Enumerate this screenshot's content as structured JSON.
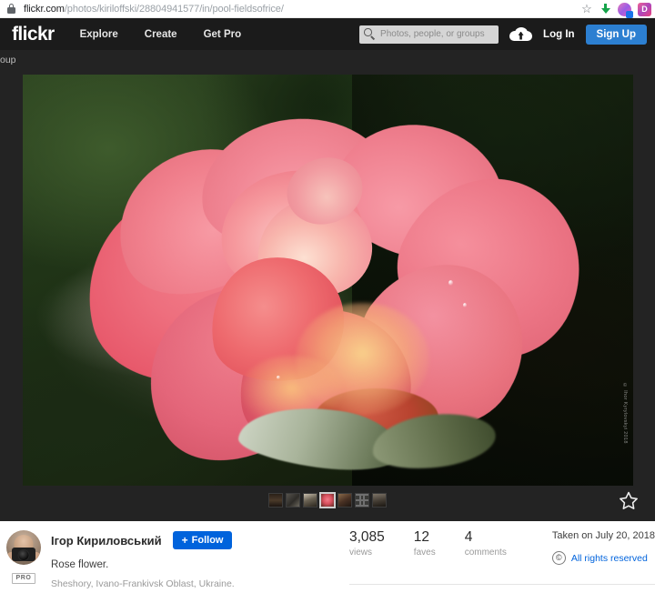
{
  "browser": {
    "url_host": "flickr.com",
    "url_path": "/photos/kiriloffski/28804941577/in/pool-fieldsofrice/",
    "lock_icon": "lock-icon",
    "bookmark_icon": "star-outline-icon",
    "download_icon": "download-arrow-icon",
    "extension_icons": [
      "extension-icon",
      "extension-icon"
    ]
  },
  "header": {
    "logo": "flickr",
    "nav": [
      {
        "label": "Explore"
      },
      {
        "label": "Create"
      },
      {
        "label": "Get Pro"
      }
    ],
    "search": {
      "placeholder": "Photos, people, or groups",
      "value": "",
      "icon": "search-icon"
    },
    "upload_icon": "cloud-upload-icon",
    "login_label": "Log In",
    "signup_label": "Sign Up",
    "signup_color": "#2c7fd1"
  },
  "breadcrumb": {
    "text": "oup"
  },
  "photo": {
    "alt": "Close-up of a pink and coral rose flower in bloom",
    "watermark": "© Ihor Kyrylovskyi 2018",
    "favorite_icon": "star-outline-icon",
    "filmstrip": [
      {
        "name": "thumbnail-1",
        "selected": false
      },
      {
        "name": "thumbnail-2",
        "selected": false
      },
      {
        "name": "thumbnail-3",
        "selected": false
      },
      {
        "name": "thumbnail-4",
        "selected": true
      },
      {
        "name": "thumbnail-5",
        "selected": false
      },
      {
        "name": "thumbnail-6",
        "selected": false
      },
      {
        "name": "thumbnail-7",
        "selected": false
      }
    ]
  },
  "owner": {
    "name": "Ігор Кириловський",
    "follow_label": "Follow",
    "follow_plus": "+",
    "follow_color": "#0063dc",
    "pro_badge": "PRO",
    "avatar": "user-avatar"
  },
  "photo_info": {
    "title": "Rose flower.",
    "location": "Sheshory, Ivano-Frankivsk Oblast, Ukraine."
  },
  "stats": {
    "items": [
      {
        "number": "3,085",
        "label": "views"
      },
      {
        "number": "12",
        "label": "faves"
      },
      {
        "number": "4",
        "label": "comments"
      }
    ],
    "taken_text": "Taken on July 20, 2018",
    "rights_icon": "copyright-icon",
    "rights_glyph": "©",
    "rights_text": "All rights reserved",
    "link_color": "#0063dc"
  }
}
